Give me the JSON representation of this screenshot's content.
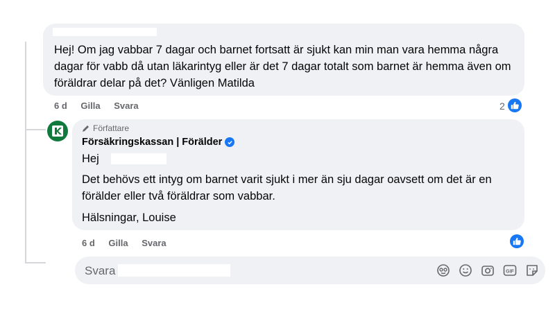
{
  "comment": {
    "text": "Hej! Om jag vabbar 7 dagar och barnet fortsatt är sjukt kan min man vara hemma några dagar för vabb då utan läkarintyg eller är det 7 dagar totalt som barnet är hemma även om föräldrar delar på det? Vänligen Matilda",
    "time": "6 d",
    "like_label": "Gilla",
    "reply_label": "Svara",
    "like_count": "2"
  },
  "reply": {
    "author_badge": "Författare",
    "author_name": "Försäkringskassan | Förälder",
    "greeting": "Hej",
    "paragraph": "Det behövs ett intyg om barnet varit sjukt i mer än sju dagar oavsett om det är en förälder eller två föräldrar som vabbar.",
    "signoff": "Hälsningar, Louise",
    "time": "6 d",
    "like_label": "Gilla",
    "reply_label": "Svara"
  },
  "composer": {
    "placeholder": "Svara",
    "icons": [
      "avatar-sticker-icon",
      "emoji-icon",
      "camera-icon",
      "gif-icon",
      "sticker-icon"
    ]
  },
  "colors": {
    "bubble": "#eff1f4",
    "like_blue": "#1877f2",
    "meta_gray": "#65676b",
    "brand_green": "#0f7a3c"
  }
}
